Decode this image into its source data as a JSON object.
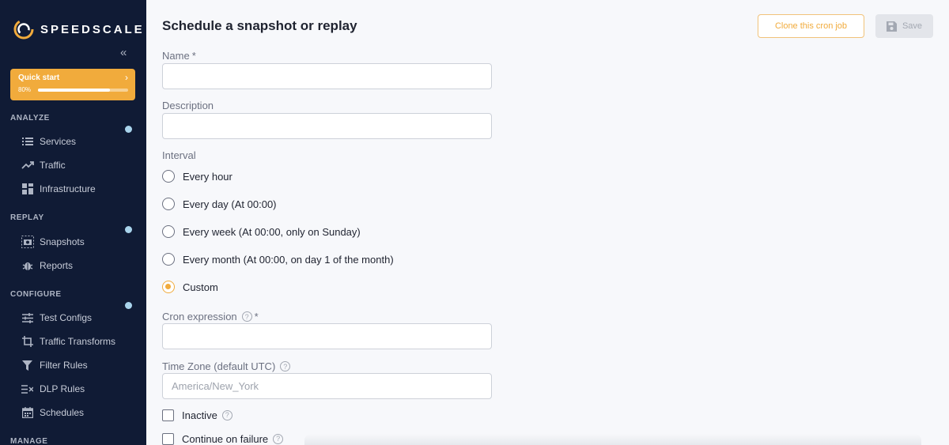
{
  "brand": {
    "name": "SPEEDSCALE"
  },
  "sidebar": {
    "collapse_glyph": "«",
    "quick_start": {
      "label": "Quick start",
      "progress_text": "80%",
      "progress": 0.8
    },
    "sections": [
      {
        "label": "ANALYZE",
        "items": [
          {
            "label": "Services",
            "icon": "list-icon"
          },
          {
            "label": "Traffic",
            "icon": "trend-icon"
          },
          {
            "label": "Infrastructure",
            "icon": "grid-icon"
          }
        ]
      },
      {
        "label": "REPLAY",
        "items": [
          {
            "label": "Snapshots",
            "icon": "camera-icon"
          },
          {
            "label": "Reports",
            "icon": "bug-icon"
          }
        ]
      },
      {
        "label": "CONFIGURE",
        "items": [
          {
            "label": "Test Configs",
            "icon": "sliders-icon"
          },
          {
            "label": "Traffic Transforms",
            "icon": "crop-icon"
          },
          {
            "label": "Filter Rules",
            "icon": "filter-icon"
          },
          {
            "label": "DLP Rules",
            "icon": "dlp-icon"
          },
          {
            "label": "Schedules",
            "icon": "calendar-icon"
          }
        ]
      },
      {
        "label": "MANAGE",
        "items": []
      }
    ]
  },
  "header": {
    "title": "Schedule a snapshot or replay",
    "clone_label": "Clone this cron job",
    "save_label": "Save"
  },
  "form": {
    "name_label": "Name",
    "description_label": "Description",
    "interval_label": "Interval",
    "required_mark": "*",
    "help_glyph": "?",
    "interval_options": [
      {
        "label": "Every hour",
        "checked": false
      },
      {
        "label": "Every day (At 00:00)",
        "checked": false
      },
      {
        "label": "Every week (At 00:00, only on Sunday)",
        "checked": false
      },
      {
        "label": "Every month (At 00:00, on day 1 of the month)",
        "checked": false
      },
      {
        "label": "Custom",
        "checked": true
      }
    ],
    "cron_label": "Cron expression",
    "timezone_label": "Time Zone (default UTC)",
    "timezone_placeholder": "America/New_York",
    "inactive_label": "Inactive",
    "continue_label": "Continue on failure"
  },
  "colors": {
    "accent": "#f1ab3c",
    "sidebar_bg": "#101b35",
    "indicator": "#a9d4ec"
  }
}
